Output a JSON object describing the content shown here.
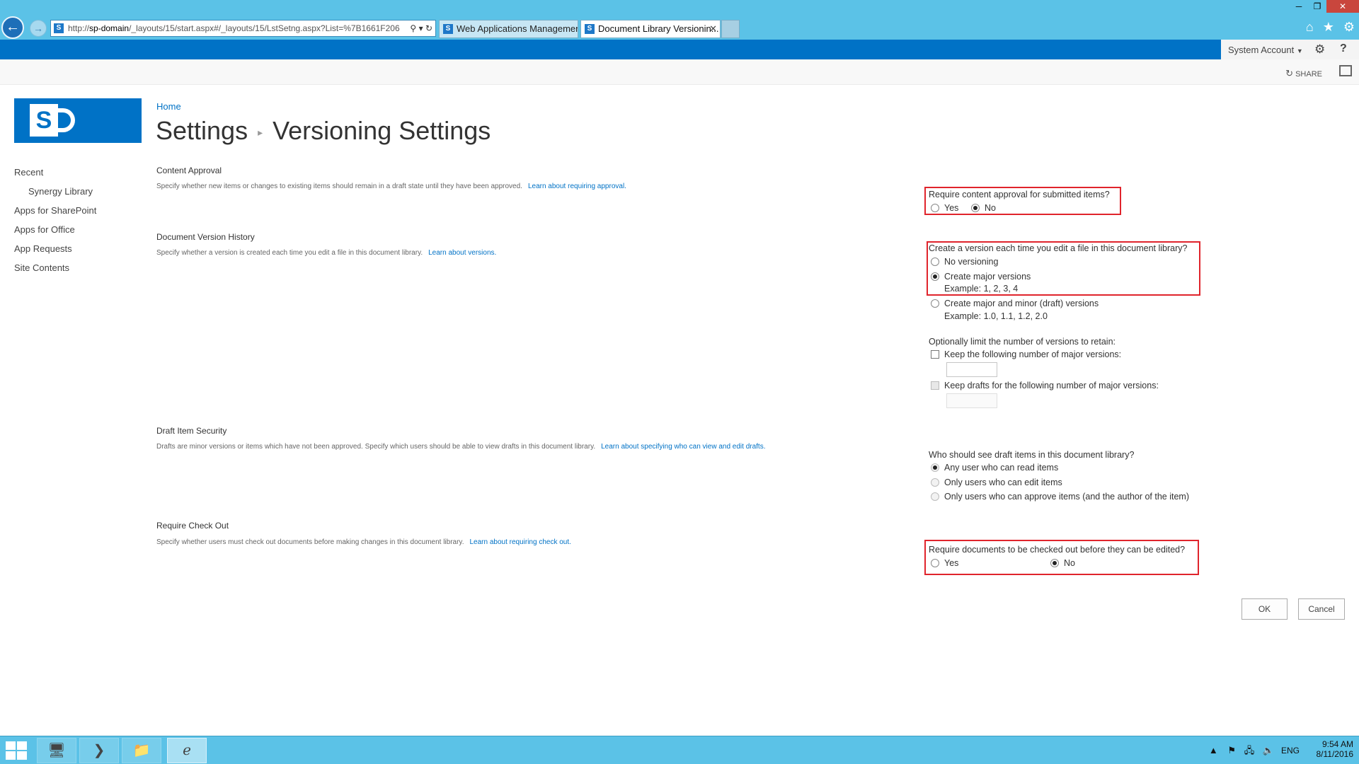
{
  "browser": {
    "url_prefix": "http://",
    "url_host": "sp-domain",
    "url_rest": "/_layouts/15/start.aspx#/_layouts/15/LstSetng.aspx?List=%7B1661F206",
    "tabs": [
      {
        "label": "Web Applications Management"
      },
      {
        "label": "Document Library Versionin..."
      }
    ]
  },
  "suite": {
    "user": "System Account"
  },
  "actions": {
    "share": "SHARE"
  },
  "breadcrumb": {
    "home": "Home"
  },
  "title": {
    "parent": "Settings",
    "current": "Versioning Settings"
  },
  "nav": {
    "items": [
      {
        "label": "Recent"
      },
      {
        "label": "Synergy Library"
      },
      {
        "label": "Apps for SharePoint"
      },
      {
        "label": "Apps for Office"
      },
      {
        "label": "App Requests"
      },
      {
        "label": "Site Contents"
      }
    ]
  },
  "content_approval": {
    "title": "Content Approval",
    "desc": "Specify whether new items or changes to existing items should remain in a draft state until they have been approved.",
    "link": "Learn about requiring approval.",
    "question": "Require content approval for submitted items?",
    "yes": "Yes",
    "no": "No",
    "selected": "No"
  },
  "version_history": {
    "title": "Document Version History",
    "desc": "Specify whether a version is created each time you edit a file in this document library.",
    "link": "Learn about versions.",
    "question": "Create a version each time you edit a file in this document library?",
    "opt_none": "No versioning",
    "opt_major": "Create major versions",
    "opt_major_example": "Example: 1, 2, 3, 4",
    "opt_minor": "Create major and minor (draft) versions",
    "opt_minor_example": "Example: 1.0, 1.1, 1.2, 2.0",
    "selected": "Create major versions",
    "limit_label": "Optionally limit the number of versions to retain:",
    "keep_major": "Keep the following number of major versions:",
    "keep_drafts": "Keep drafts for the following number of major versions:"
  },
  "draft_security": {
    "title": "Draft Item Security",
    "desc": "Drafts are minor versions or items which have not been approved. Specify which users should be able to view drafts in this document library.",
    "link": "Learn about specifying who can view and edit drafts.",
    "question": "Who should see draft items in this document library?",
    "opt_read": "Any user who can read items",
    "opt_edit": "Only users who can edit items",
    "opt_approve": "Only users who can approve items (and the author of the item)",
    "selected": "Any user who can read items"
  },
  "check_out": {
    "title": "Require Check Out",
    "desc": "Specify whether users must check out documents before making changes in this document library.",
    "link": "Learn about requiring check out.",
    "question": "Require documents to be checked out before they can be edited?",
    "yes": "Yes",
    "no": "No",
    "selected": "No"
  },
  "buttons": {
    "ok": "OK",
    "cancel": "Cancel"
  },
  "taskbar": {
    "lang": "ENG",
    "time": "9:54 AM",
    "date": "8/11/2016"
  },
  "colors": {
    "suite_bar": "#0072c6",
    "link": "#0072c6",
    "highlight": "#e0242c",
    "taskbar": "#5bc2e7"
  }
}
